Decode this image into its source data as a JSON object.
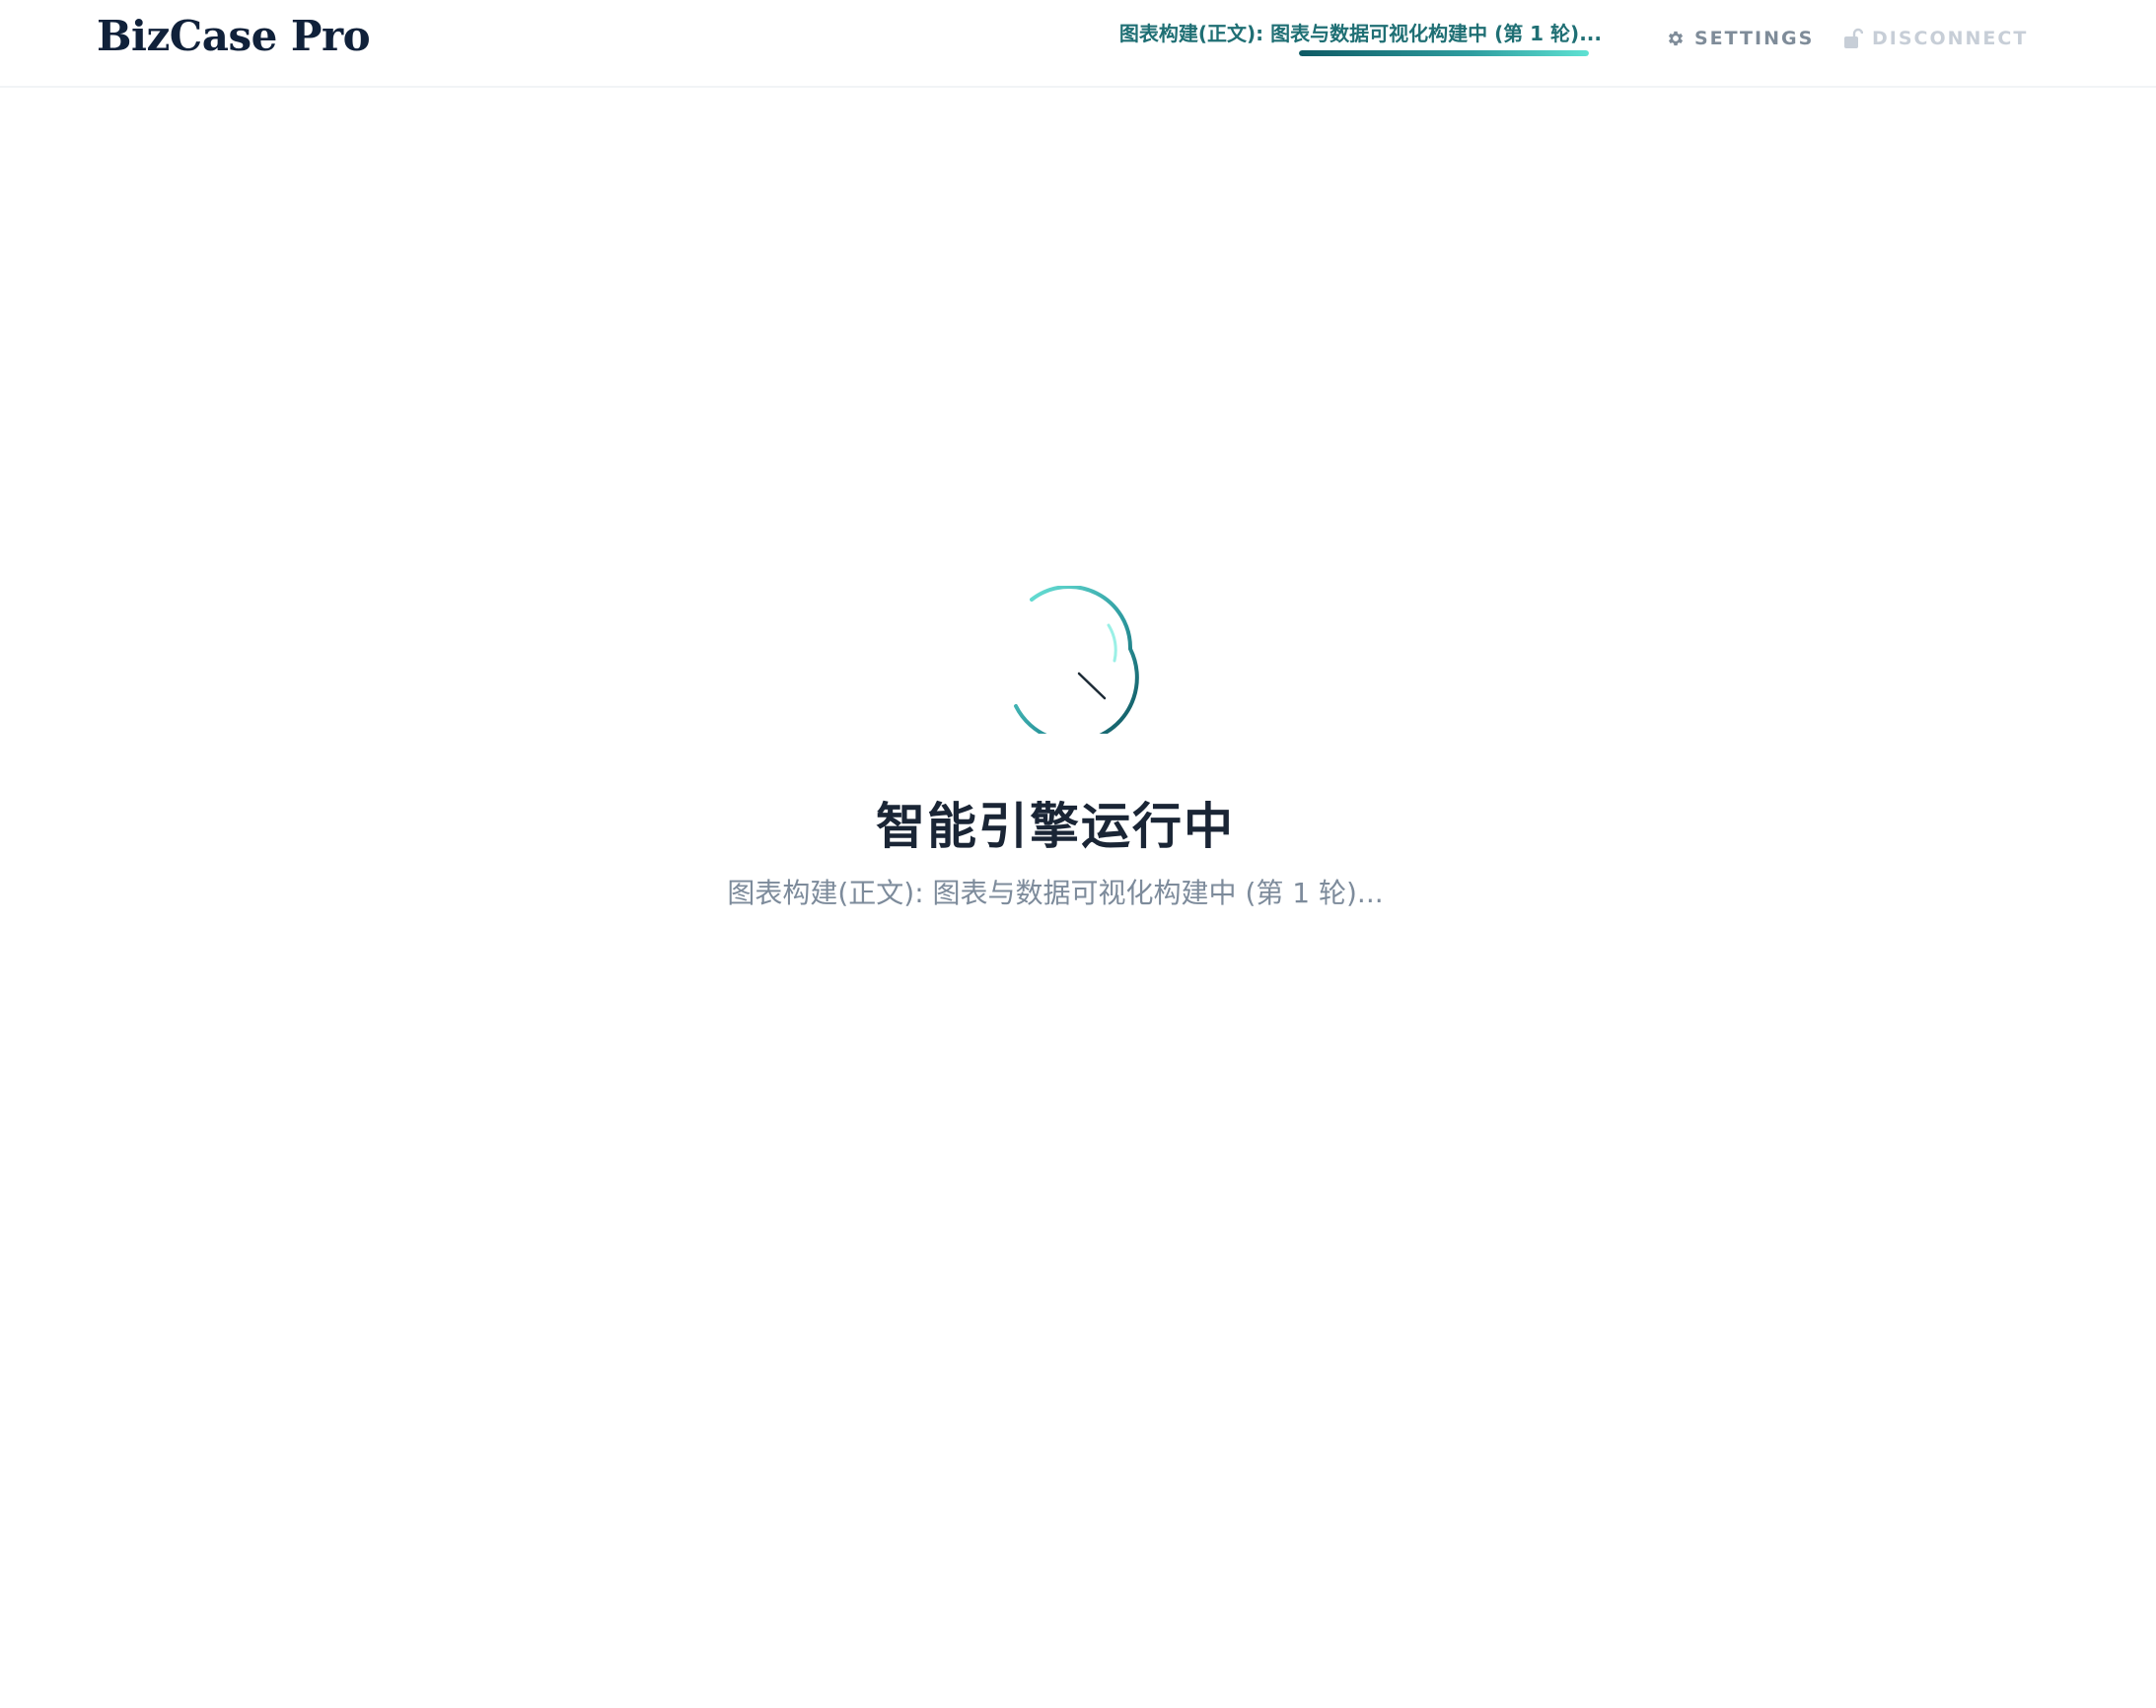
{
  "app": {
    "brand": "BizCase Pro"
  },
  "header": {
    "status_text": "图表构建(正文): 图表与数据可视化构建中 (第 1 轮)...",
    "progress": 1.0,
    "settings_label": "SETTINGS",
    "disconnect_label": "DISCONNECT",
    "settings_icon": "gear-icon",
    "disconnect_icon": "unlock-icon"
  },
  "main": {
    "title": "智能引擎运行中",
    "subtitle": "图表构建(正文): 图表与数据可视化构建中 (第 1 轮)...",
    "spinner_icon": "loading-spinner-icon"
  },
  "colors": {
    "accent": "#1f6f74",
    "accent_light": "#5fe2d3",
    "title": "#1a2535",
    "muted": "#7d8b9b",
    "disabled": "#c7ced7"
  }
}
